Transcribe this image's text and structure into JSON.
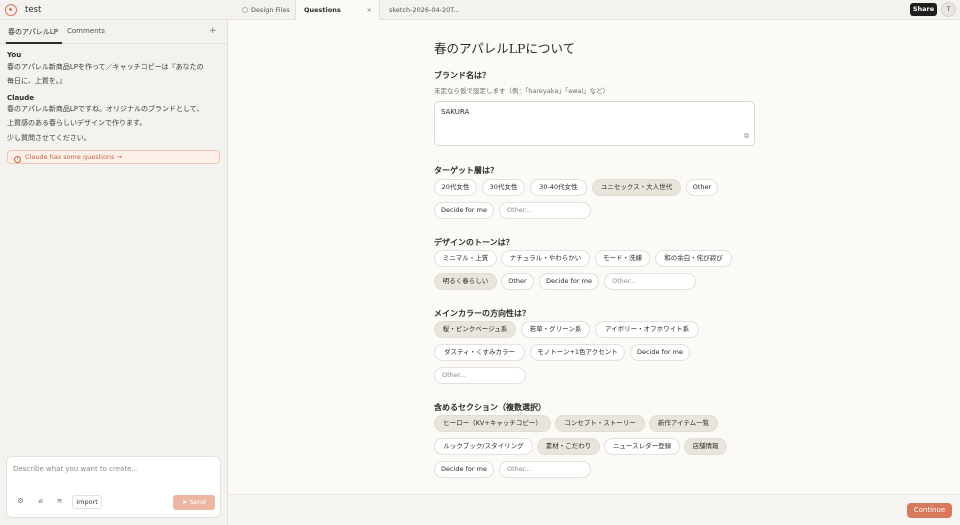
{
  "app": {
    "project_title": "test",
    "tabs": [
      {
        "label": "Design Files"
      },
      {
        "label": "Questions",
        "close": "×"
      },
      {
        "label": "sketch-2026-04-20T..."
      }
    ],
    "share_label": "Share",
    "avatar_initial": "T"
  },
  "sidebar": {
    "tabs": [
      "春のアパレルLP",
      "Comments"
    ],
    "add_icon": "+",
    "messages": [
      {
        "author": "You",
        "lines": [
          "春のアパレル新商品LPを作って／キャッチコピーは『あなたの",
          "毎日に、上質を。』"
        ]
      },
      {
        "author": "Claude",
        "lines": [
          "春のアパレル新商品LPですね。オリジナルのブランドとして、",
          "上質感のある春らしいデザインで作ります。",
          "少し質問させてください。"
        ]
      }
    ],
    "questions_pill": "Claude has some questions →",
    "composer": {
      "placeholder": "Describe what you want to create...",
      "import_label": "Import",
      "send_label": "Send"
    }
  },
  "main": {
    "title": "春のアパレルLPについて",
    "q1": {
      "label": "ブランド名は？",
      "hint": "未定なら仮で設定します（例：「hareyaka」「awai」など）",
      "value": "SAKURA"
    },
    "q2": {
      "label": "ターゲット層は？",
      "options": [
        "20代女性",
        "30代女性",
        "30-40代女性",
        "ユニセックス・大人世代",
        "Other",
        "Decide for me"
      ],
      "other_placeholder": "Other..."
    },
    "q3": {
      "label": "デザインのトーンは？",
      "options": [
        "ミニマル・上質",
        "ナチュラル・やわらかい",
        "モード・洗練",
        "和の余白・侘び寂び",
        "明るく春らしい",
        "Other",
        "Decide for me"
      ],
      "other_placeholder": "Other..."
    },
    "q4": {
      "label": "メインカラーの方向性は？",
      "options": [
        "桜・ピンクベージュ系",
        "若草・グリーン系",
        "アイボリー・オフホワイト系",
        "ダスティ・くすみカラー",
        "モノトーン+1色アクセント",
        "Decide for me"
      ],
      "other_placeholder": "Other..."
    },
    "q5": {
      "label": "含めるセクション（複数選択）",
      "options": [
        "ヒーロー（KV+キャッチコピー）",
        "コンセプト・ストーリー",
        "新作アイテム一覧",
        "ルックブック/スタイリング",
        "素材・こだわり",
        "ニュースレター登録",
        "店舗情報",
        "Decide for me"
      ],
      "other_placeholder": "Other..."
    },
    "continue_label": "Continue"
  }
}
